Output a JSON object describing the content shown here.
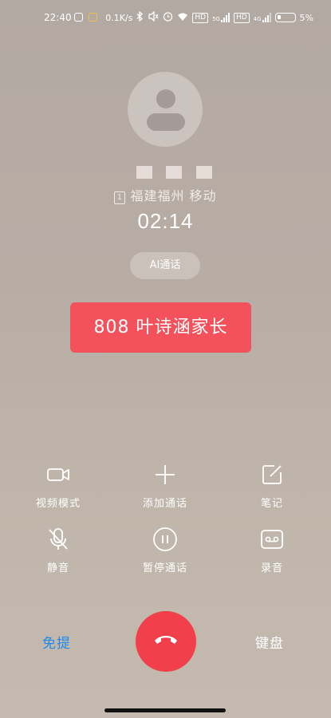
{
  "status_bar": {
    "time": "22:40",
    "net_speed": "0.1K/s",
    "hd1": "HD",
    "sig1": "5G",
    "hd2": "HD",
    "sig2": "4G",
    "battery": "5%"
  },
  "caller": {
    "sim_slot": "1",
    "location": "福建福州 移动",
    "duration": "02:14"
  },
  "ai_call": {
    "label": "AI通话"
  },
  "banner": {
    "text": "808 叶诗涵家长",
    "color": "#f3525c"
  },
  "actions": {
    "video_mode": "视频模式",
    "add_call": "添加通话",
    "notes": "笔记",
    "mute": "静音",
    "hold": "暂停通话",
    "record": "录音"
  },
  "bottom": {
    "speaker": "免提",
    "keypad": "键盘",
    "speaker_color": "#1e8be8",
    "hangup_color": "#f1404b"
  }
}
